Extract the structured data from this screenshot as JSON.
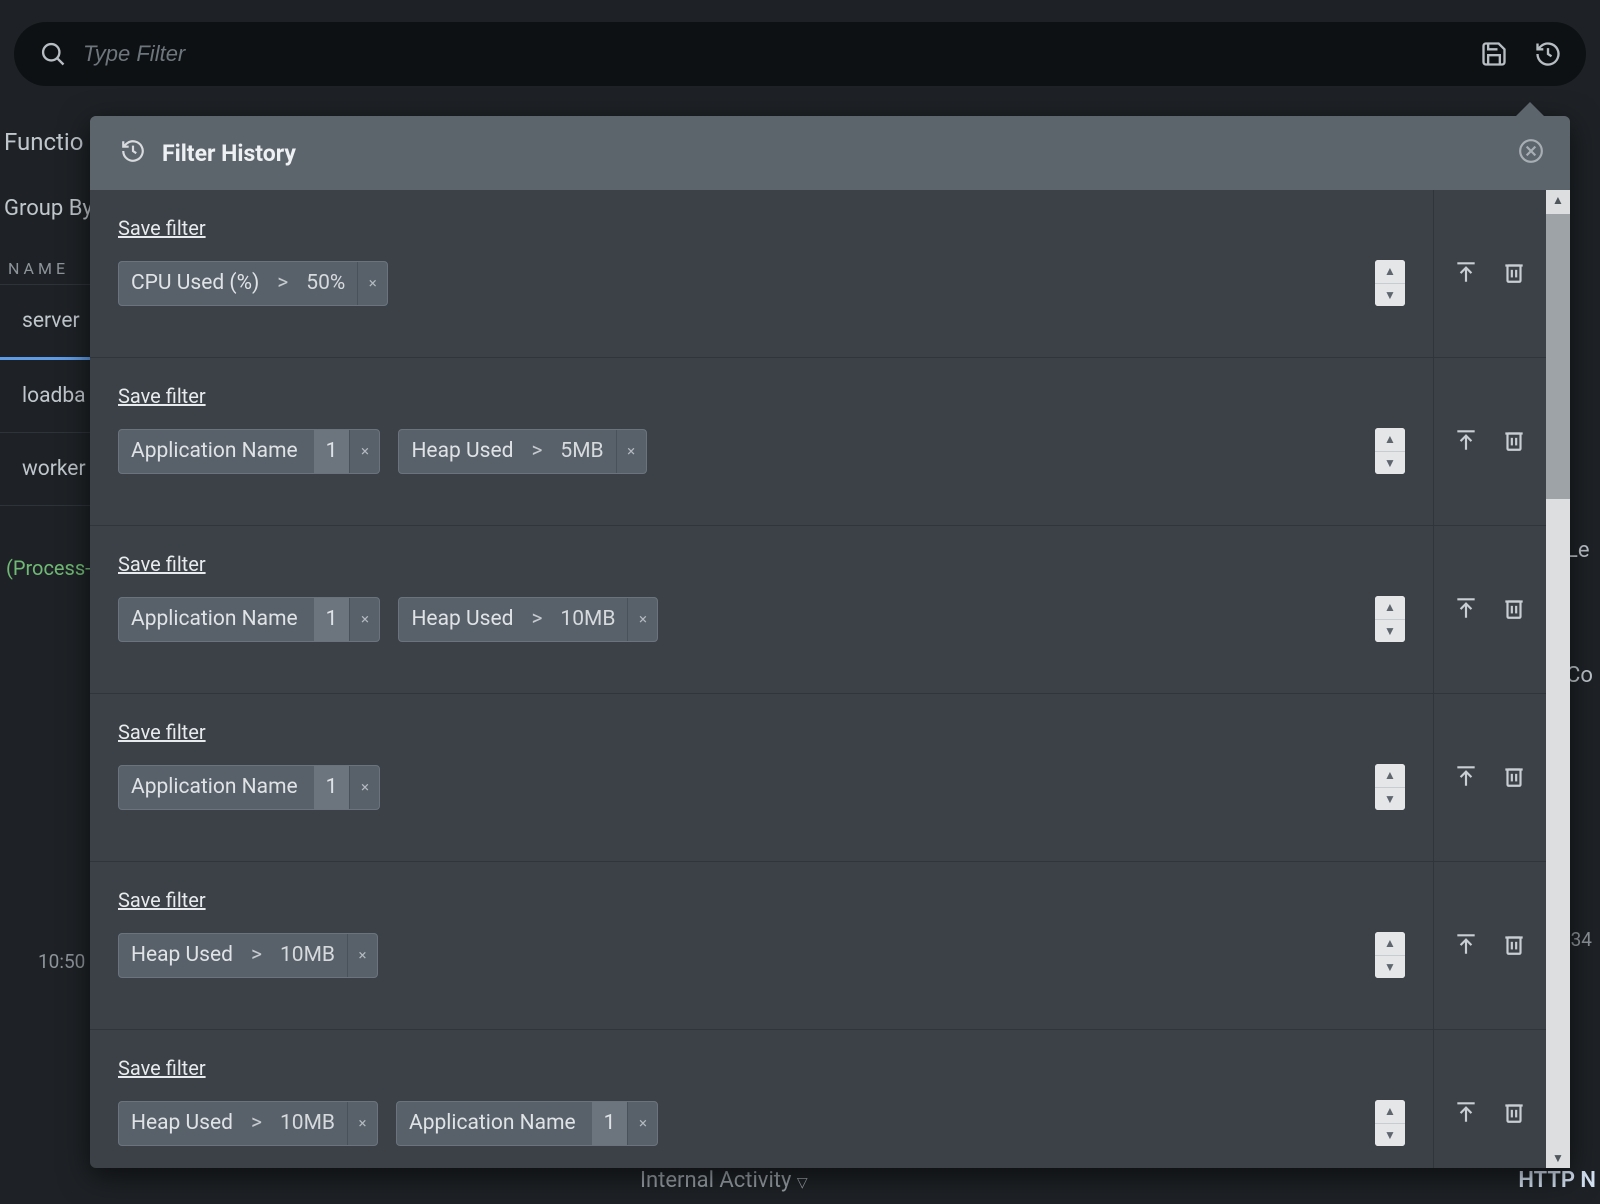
{
  "topbar": {
    "search_placeholder": "Type Filter"
  },
  "background": {
    "section_label": "Functio",
    "group_by_label": "Group By",
    "column_header": "NAME",
    "rows": [
      "server",
      "loadba",
      "worker"
    ],
    "process_label": "(Process-",
    "time_label": "10:50",
    "right_label_1": "Le",
    "right_label_2": "Co",
    "right_time": ":34",
    "internal_activity": "Internal Activity",
    "http_label": "HTTP N"
  },
  "popover": {
    "title": "Filter History",
    "save_label": "Save filter",
    "history": [
      {
        "chips": [
          {
            "label": "CPU Used (%)",
            "op": ">",
            "value": "50%"
          }
        ]
      },
      {
        "chips": [
          {
            "label": "Application Name",
            "count": "1"
          },
          {
            "label": "Heap Used",
            "op": ">",
            "value": "5MB"
          }
        ]
      },
      {
        "chips": [
          {
            "label": "Application Name",
            "count": "1"
          },
          {
            "label": "Heap Used",
            "op": ">",
            "value": "10MB"
          }
        ]
      },
      {
        "chips": [
          {
            "label": "Application Name",
            "count": "1"
          }
        ]
      },
      {
        "chips": [
          {
            "label": "Heap Used",
            "op": ">",
            "value": "10MB"
          }
        ]
      },
      {
        "chips": [
          {
            "label": "Heap Used",
            "op": ">",
            "value": "10MB"
          },
          {
            "label": "Application Name",
            "count": "1"
          }
        ]
      }
    ]
  }
}
